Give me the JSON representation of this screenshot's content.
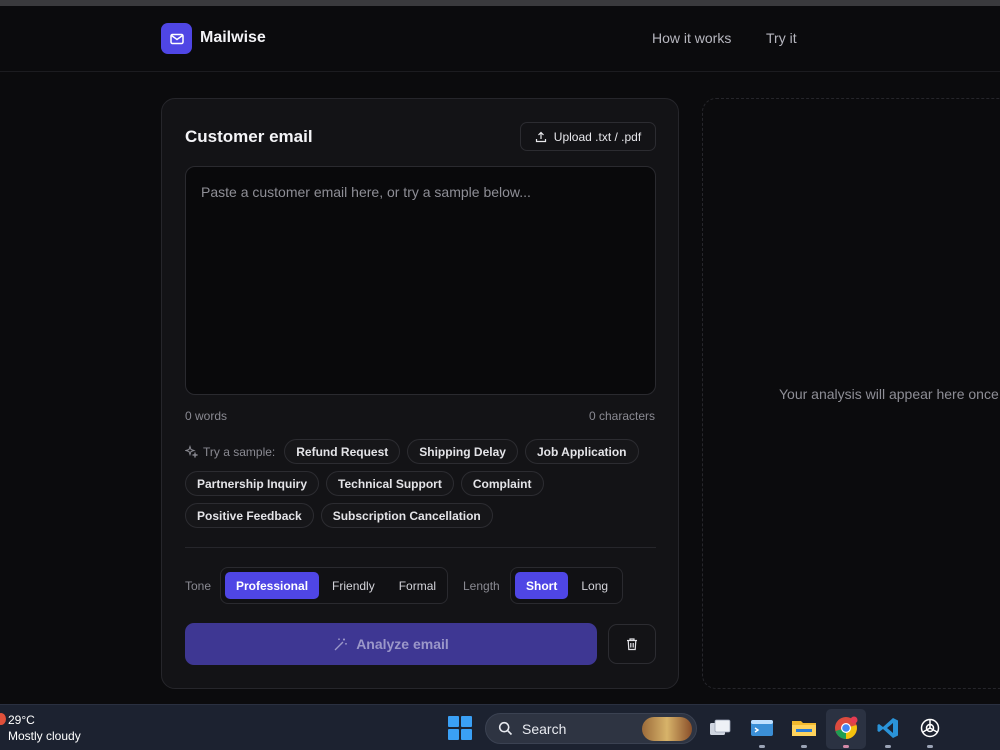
{
  "header": {
    "brand": "Mailwise",
    "nav": [
      "How it works",
      "Try it"
    ]
  },
  "composer": {
    "title": "Customer email",
    "upload_label": "Upload .txt / .pdf",
    "placeholder": "Paste a customer email here, or try a sample below...",
    "value": "",
    "words": "0 words",
    "characters": "0 characters",
    "sample_label": "Try a sample:",
    "samples": [
      "Refund Request",
      "Shipping Delay",
      "Job Application",
      "Partnership Inquiry",
      "Technical Support",
      "Complaint",
      "Positive Feedback",
      "Subscription Cancellation"
    ],
    "tone": {
      "label": "Tone",
      "options": [
        "Professional",
        "Friendly",
        "Formal"
      ],
      "selected": "Professional"
    },
    "length": {
      "label": "Length",
      "options": [
        "Short",
        "Long"
      ],
      "selected": "Short"
    },
    "analyze_label": "Analyze email"
  },
  "result": {
    "empty_text": "Your analysis will appear here once"
  },
  "taskbar": {
    "weather_temp": "29°C",
    "weather_desc": "Mostly cloudy",
    "search_label": "Search",
    "apps": [
      "task-view-icon",
      "terminal-icon",
      "file-explorer-icon",
      "chrome-icon",
      "vscode-icon",
      "chatgpt-icon"
    ]
  },
  "colors": {
    "accent": "#4f46e5",
    "background": "#0b0b0d",
    "card": "#131316"
  }
}
